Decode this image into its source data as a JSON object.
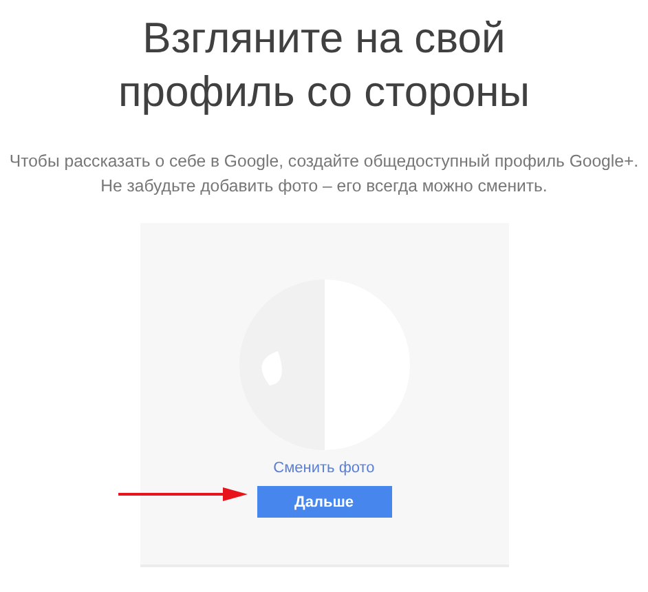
{
  "title": "Взгляните на свой профиль со стороны",
  "description": [
    "Чтобы рассказать о себе в Google, создайте общедоступный профиль Google+.",
    "Не забудьте добавить фото – его всегда можно сменить."
  ],
  "card": {
    "change_photo_link": "Сменить фото",
    "next_button": "Дальше"
  },
  "annotation": {
    "kind": "arrow",
    "color": "#e8141b"
  }
}
